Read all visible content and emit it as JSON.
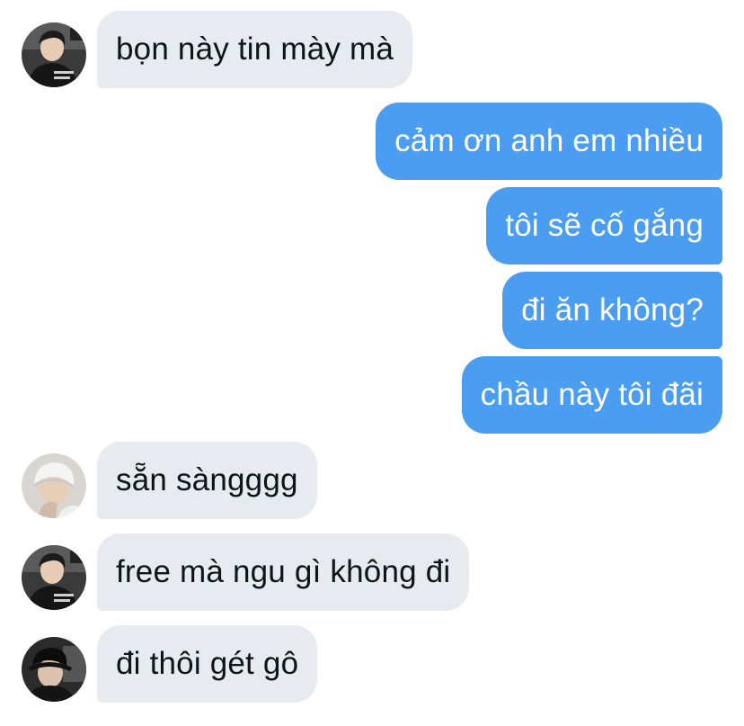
{
  "messages": [
    {
      "id": 1,
      "direction": "incoming",
      "sender_avatar": "avatar-dark-hoodie-icon",
      "text": "bọn này tin mày mà"
    },
    {
      "id": 2,
      "direction": "outgoing",
      "text": "cảm ơn anh em nhiều"
    },
    {
      "id": 3,
      "direction": "outgoing",
      "text": "tôi sẽ cố gắng"
    },
    {
      "id": 4,
      "direction": "outgoing",
      "text": "đi ăn không?"
    },
    {
      "id": 5,
      "direction": "outgoing",
      "text": "chầu này tôi đãi"
    },
    {
      "id": 6,
      "direction": "incoming",
      "sender_avatar": "avatar-white-beanie-icon",
      "text": "sẵn sàngggg"
    },
    {
      "id": 7,
      "direction": "incoming",
      "sender_avatar": "avatar-dark-hoodie-icon",
      "text": "free mà ngu gì không đi"
    },
    {
      "id": 8,
      "direction": "incoming",
      "sender_avatar": "avatar-black-cap-icon",
      "text": "đi thôi gét gô"
    }
  ],
  "colors": {
    "incoming_bubble": "#e7ebef",
    "incoming_text": "#0f1419",
    "outgoing_bubble": "#4a9df0",
    "outgoing_text": "#ffffff"
  }
}
